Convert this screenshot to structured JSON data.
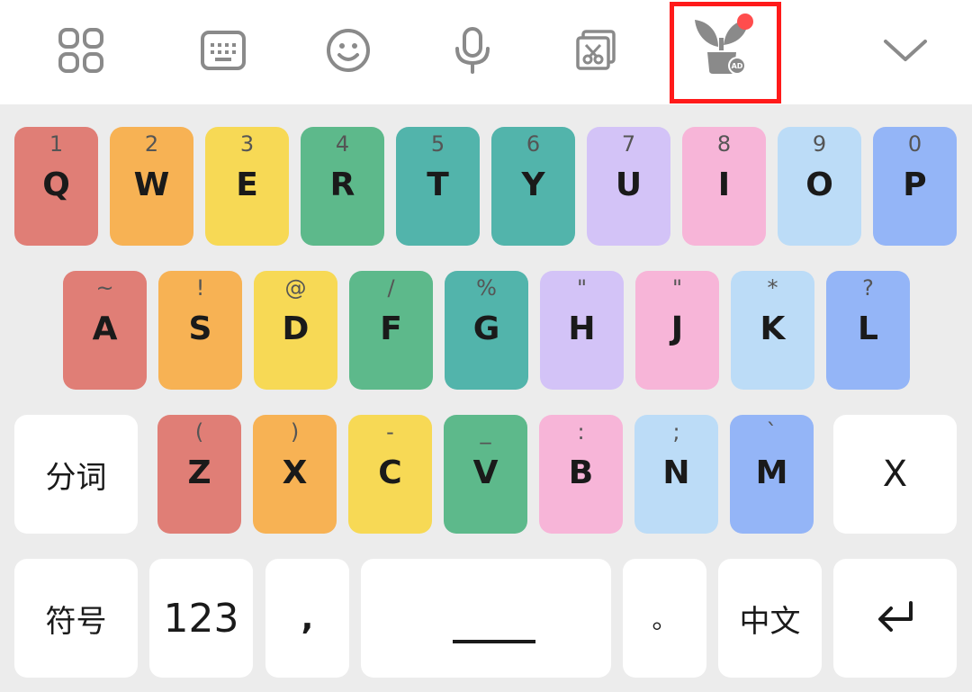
{
  "colors": {
    "red": "#e07e76",
    "orange": "#f7b254",
    "yellow": "#f7d955",
    "green": "#5db98b",
    "teal": "#52b4ab",
    "lavender": "#d3c3f7",
    "pink": "#f7b5d8",
    "light_blue": "#bcdcf7",
    "blue": "#94b5f7",
    "white_key": "#ffffff",
    "toolbar_icon": "#8a8a8a",
    "ad_badge": "#ff4d4d",
    "highlight": "#ff1a1a"
  },
  "toolbar": {
    "items": [
      {
        "id": "apps",
        "icon": "grid-icon"
      },
      {
        "id": "keyboard",
        "icon": "keyboard-icon"
      },
      {
        "id": "emoji",
        "icon": "emoji-icon"
      },
      {
        "id": "voice",
        "icon": "microphone-icon"
      },
      {
        "id": "clipboard",
        "icon": "clipboard-icon"
      },
      {
        "id": "ad_plant",
        "icon": "plant-ad-icon",
        "badge": "AD"
      },
      {
        "id": "collapse",
        "icon": "chevron-down-icon"
      }
    ]
  },
  "rows": {
    "row1": [
      {
        "top": "1",
        "main": "Q",
        "color": "red"
      },
      {
        "top": "2",
        "main": "W",
        "color": "orange"
      },
      {
        "top": "3",
        "main": "E",
        "color": "yellow"
      },
      {
        "top": "4",
        "main": "R",
        "color": "green"
      },
      {
        "top": "5",
        "main": "T",
        "color": "teal"
      },
      {
        "top": "6",
        "main": "Y",
        "color": "teal"
      },
      {
        "top": "7",
        "main": "U",
        "color": "lavender"
      },
      {
        "top": "8",
        "main": "I",
        "color": "pink"
      },
      {
        "top": "9",
        "main": "O",
        "color": "light_blue"
      },
      {
        "top": "0",
        "main": "P",
        "color": "blue"
      }
    ],
    "row2": [
      {
        "top": "~",
        "main": "A",
        "color": "red"
      },
      {
        "top": "!",
        "main": "S",
        "color": "orange"
      },
      {
        "top": "@",
        "main": "D",
        "color": "yellow"
      },
      {
        "top": "/",
        "main": "F",
        "color": "green"
      },
      {
        "top": "%",
        "main": "G",
        "color": "teal"
      },
      {
        "top": "\"",
        "main": "H",
        "color": "lavender"
      },
      {
        "top": "\"",
        "main": "J",
        "color": "pink"
      },
      {
        "top": "*",
        "main": "K",
        "color": "light_blue"
      },
      {
        "top": "?",
        "main": "L",
        "color": "blue"
      }
    ],
    "row3": [
      {
        "top": "(",
        "main": "Z",
        "color": "red"
      },
      {
        "top": ")",
        "main": "X",
        "color": "orange"
      },
      {
        "top": "-",
        "main": "C",
        "color": "yellow"
      },
      {
        "top": "_",
        "main": "V",
        "color": "green"
      },
      {
        "top": ":",
        "main": "B",
        "color": "pink"
      },
      {
        "top": ";",
        "main": "N",
        "color": "light_blue"
      },
      {
        "top": "`",
        "main": "M",
        "color": "blue"
      }
    ]
  },
  "function_keys": {
    "segment": "分词",
    "delete": "X",
    "symbols": "符号",
    "numbers": "123",
    "comma": ",",
    "period": "。",
    "language": "中文"
  }
}
